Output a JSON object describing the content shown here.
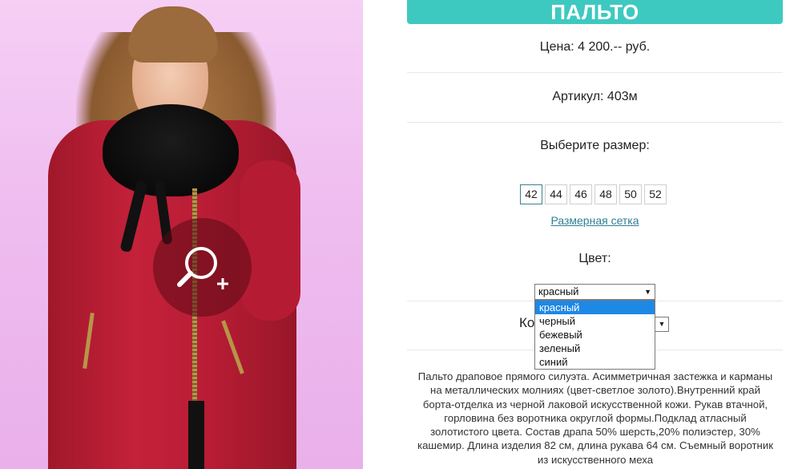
{
  "product": {
    "title": "ПАЛЬТО",
    "price": "Цена: 4 200.-- руб.",
    "article": "Артикул: 403м",
    "size_prompt": "Выберите размер:",
    "sizes": [
      "42",
      "44",
      "46",
      "48",
      "50",
      "52"
    ],
    "selected_size": "42",
    "size_chart_link": "Размерная сетка",
    "color_label": "Цвет:",
    "color_select": {
      "value": "красный",
      "options": [
        "красный",
        "черный",
        "бежевый",
        "зеленый",
        "синий"
      ]
    },
    "quantity_label": "Ко",
    "description": "Пальто драповое прямого силуэта. Асимметричная застежка и карманы на металлических молниях (цвет-светлое золото).Внутренний край борта-отделка из черной лаковой искусственной кожи. Рукав втачной, горловина без воротника округлой формы.Подклад атласный золотистого цвета. Состав драпа 50% шерсть,20% полиэстер, 30% кашемир. Длина изделия 82 см, длина рукава 64 см. Съемный воротник из искусственного меха"
  },
  "colors": {
    "title_bar": "#3ec9c0",
    "link": "#2f7f96",
    "dropdown_highlight": "#1e88e5"
  },
  "icons": {
    "zoom": "zoom-in-icon"
  }
}
